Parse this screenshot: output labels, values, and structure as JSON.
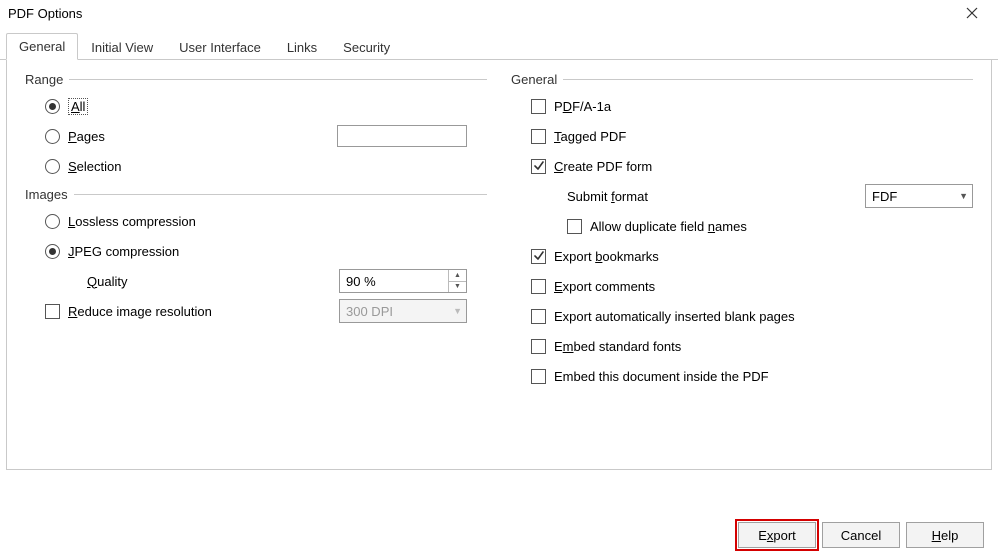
{
  "window": {
    "title": "PDF Options"
  },
  "tabs": [
    {
      "label": "General",
      "active": true
    },
    {
      "label": "Initial View"
    },
    {
      "label": "User Interface"
    },
    {
      "label": "Links"
    },
    {
      "label": "Security"
    }
  ],
  "range": {
    "heading": "Range",
    "all": "All",
    "pages": "Pages",
    "pages_value": "",
    "selection": "Selection"
  },
  "images": {
    "heading": "Images",
    "lossless": "Lossless compression",
    "jpeg": "JPEG compression",
    "quality_label": "Quality",
    "quality_value": "90 %",
    "reduce": "Reduce image resolution",
    "reduce_value": "300 DPI"
  },
  "general": {
    "heading": "General",
    "pdfa": "PDF/A-1a",
    "tagged": "Tagged PDF",
    "create_form": "Create PDF form",
    "submit_label": "Submit format",
    "submit_value": "FDF",
    "allow_dup": "Allow duplicate field names",
    "export_bookmarks": "Export bookmarks",
    "export_comments": "Export comments",
    "export_blank": "Export automatically inserted blank pages",
    "embed_fonts": "Embed standard fonts",
    "embed_doc": "Embed this document inside the PDF"
  },
  "footer": {
    "export": "Export",
    "cancel": "Cancel",
    "help": "Help"
  }
}
